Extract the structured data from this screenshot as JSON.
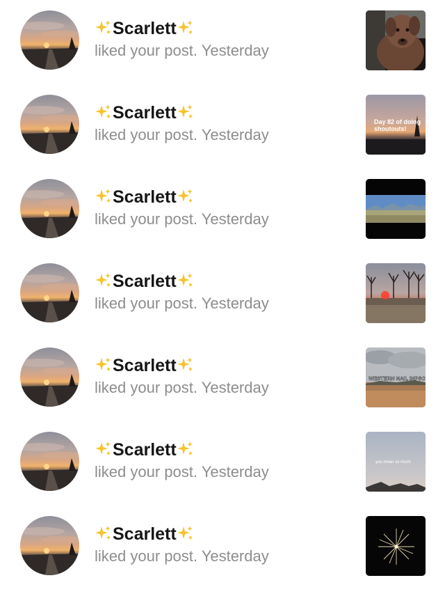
{
  "notifications": [
    {
      "user": "Scarlett",
      "action": "liked your post.",
      "time": "Yesterday",
      "post_icon": "dog-photo"
    },
    {
      "user": "Scarlett",
      "action": "liked your post.",
      "time": "Yesterday",
      "post_icon": "sunset-text-photo",
      "post_caption": "Day 82 of doing shoutouts!"
    },
    {
      "user": "Scarlett",
      "action": "liked your post.",
      "time": "Yesterday",
      "post_icon": "field-landscape-photo"
    },
    {
      "user": "Scarlett",
      "action": "liked your post.",
      "time": "Yesterday",
      "post_icon": "sunset-trees-photo"
    },
    {
      "user": "Scarlett",
      "action": "liked your post.",
      "time": "Yesterday",
      "post_icon": "cloudy-field-photo",
      "post_caption": "WESTERN NAIL INPSO"
    },
    {
      "user": "Scarlett",
      "action": "liked your post.",
      "time": "Yesterday",
      "post_icon": "sky-text-photo",
      "post_caption": "you mean so much"
    },
    {
      "user": "Scarlett",
      "action": "liked your post.",
      "time": "Yesterday",
      "post_icon": "fireworks-photo"
    }
  ],
  "avatar_icon": "sunset-road-avatar",
  "sparkle_icon": "sparkles-emoji",
  "colors": {
    "name_text": "#161616",
    "secondary_text": "#8d8d8d",
    "sparkle": "#f4c430",
    "background": "#ffffff"
  }
}
